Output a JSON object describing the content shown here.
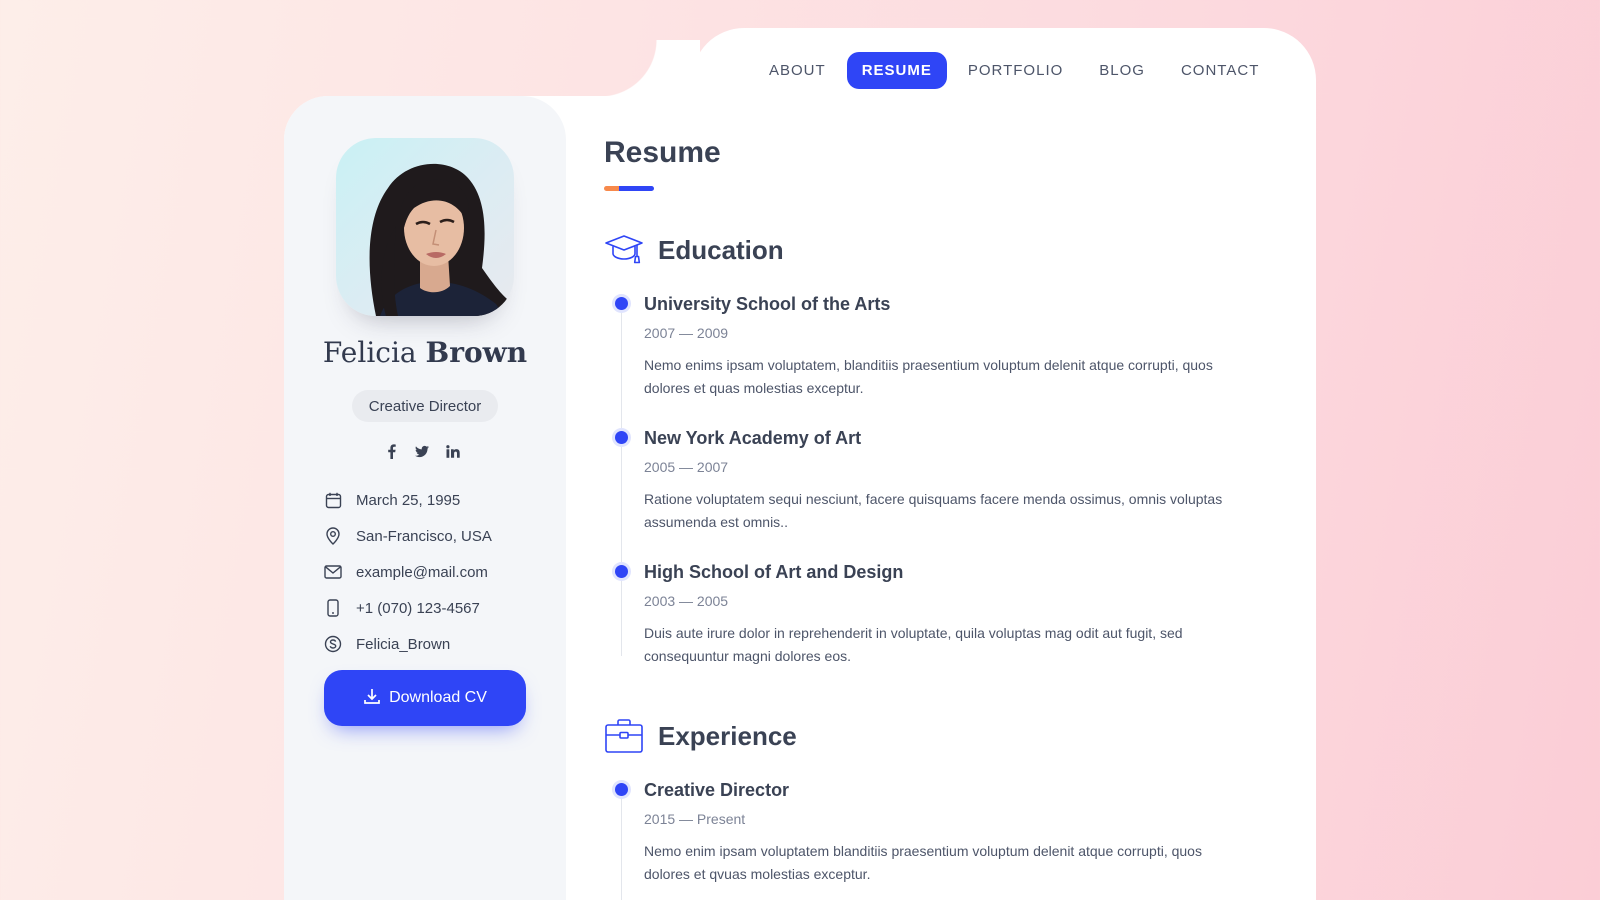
{
  "nav": {
    "items": [
      {
        "label": "ABOUT",
        "active": false
      },
      {
        "label": "RESUME",
        "active": true
      },
      {
        "label": "PORTFOLIO",
        "active": false
      },
      {
        "label": "BLOG",
        "active": false
      },
      {
        "label": "CONTACT",
        "active": false
      }
    ]
  },
  "profile": {
    "first_name": "Felicia",
    "last_name": "Brown",
    "role": "Creative Director",
    "socials": [
      "facebook-icon",
      "twitter-icon",
      "linkedin-icon"
    ],
    "info": [
      {
        "icon": "calendar-icon",
        "text": "March 25, 1995"
      },
      {
        "icon": "location-icon",
        "text": "San-Francisco, USA"
      },
      {
        "icon": "mail-icon",
        "text": "example@mail.com"
      },
      {
        "icon": "phone-icon",
        "text": "+1 (070) 123-4567"
      },
      {
        "icon": "skype-icon",
        "text": "Felicia_Brown"
      }
    ],
    "download_label": "Download CV"
  },
  "resume": {
    "title": "Resume",
    "education": {
      "title": "Education",
      "items": [
        {
          "title": "University School of the Arts",
          "date": "2007 — 2009",
          "desc": "Nemo enims ipsam voluptatem, blanditiis praesentium voluptum delenit atque corrupti, quos dolores et quas molestias exceptur."
        },
        {
          "title": "New York Academy of Art",
          "date": "2005 — 2007",
          "desc": "Ratione voluptatem sequi nesciunt, facere quisquams facere menda ossimus, omnis voluptas assumenda est omnis.."
        },
        {
          "title": "High School of Art and Design",
          "date": "2003 — 2005",
          "desc": "Duis aute irure dolor in reprehenderit in voluptate, quila voluptas mag odit aut fugit, sed consequuntur magni dolores eos."
        }
      ]
    },
    "experience": {
      "title": "Experience",
      "items": [
        {
          "title": "Creative Director",
          "date": "2015 — Present",
          "desc": "Nemo enim ipsam voluptatem blanditiis praesentium voluptum delenit atque corrupti, quos dolores et qvuas molestias exceptur."
        }
      ]
    }
  },
  "colors": {
    "accent": "#2f45f6",
    "accent_orange": "#f7894b",
    "text_dark": "#3a4254",
    "sidebar_bg": "#f4f6f9"
  }
}
